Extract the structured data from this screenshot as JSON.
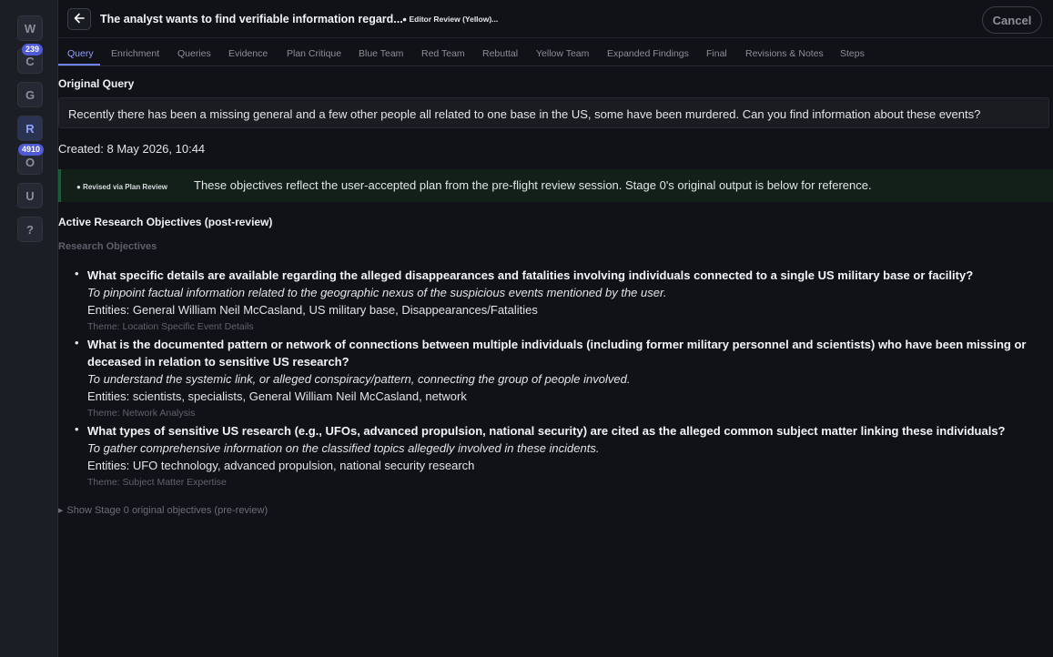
{
  "rail": {
    "items": [
      "W",
      "C",
      "G",
      "R",
      "O",
      "U",
      "?"
    ],
    "badges": [
      "239",
      "4910"
    ],
    "active": "R"
  },
  "header": {
    "back_icon": "arrow-left-icon",
    "title": "The analyst wants to find verifiable information regard...",
    "status": "● Editor Review (Yellow)...",
    "cancel_label": "Cancel"
  },
  "tabs": [
    "Query",
    "Enrichment",
    "Queries",
    "Evidence",
    "Plan Critique",
    "Blue Team",
    "Red Team",
    "Rebuttal",
    "Yellow Team",
    "Expanded Findings",
    "Final",
    "Revisions & Notes",
    "Steps"
  ],
  "query": {
    "heading": "Original Query",
    "text": "Recently there has been a missing general and a few other people all related to one base in the US, some have been murdered. Can you find information about these events?",
    "created": "Created: 8 May 2026, 10:44"
  },
  "notice": {
    "badge": "● Revised via Plan Review",
    "text": "These objectives reflect the user-accepted plan from the pre-flight review session. Stage 0's original output is below for reference."
  },
  "objectives": {
    "heading": "Active Research Objectives (post-review)",
    "sublabel": "Research Objectives",
    "items": [
      {
        "question": "What specific details are available regarding the alleged disappearances and fatalities involving individuals connected to a single US military base or facility?",
        "rationale": "To pinpoint factual information related to the geographic nexus of the suspicious events mentioned by the user.",
        "entities": "Entities: General William Neil McCasland, US military base, Disappearances/Fatalities",
        "theme": "Theme: Location Specific Event Details"
      },
      {
        "question": "What is the documented pattern or network of connections between multiple individuals (including former military personnel and scientists) who have been missing or deceased in relation to sensitive US research?",
        "rationale": "To understand the systemic link, or alleged conspiracy/pattern, connecting the group of people involved.",
        "entities": "Entities: scientists, specialists, General William Neil McCasland, network",
        "theme": "Theme: Network Analysis"
      },
      {
        "question": "What types of sensitive US research (e.g., UFOs, advanced propulsion, national security) are cited as the alleged common subject matter linking these individuals?",
        "rationale": "To gather comprehensive information on the classified topics allegedly involved in these incidents.",
        "entities": "Entities: UFO technology, advanced propulsion, national security research",
        "theme": "Theme: Subject Matter Expertise"
      }
    ],
    "show_original": "Show Stage 0 original objectives (pre-review)"
  },
  "colors": {
    "accent": "#6f82ff",
    "badge": "#4f5bd6",
    "notice_bg": "#122019"
  }
}
